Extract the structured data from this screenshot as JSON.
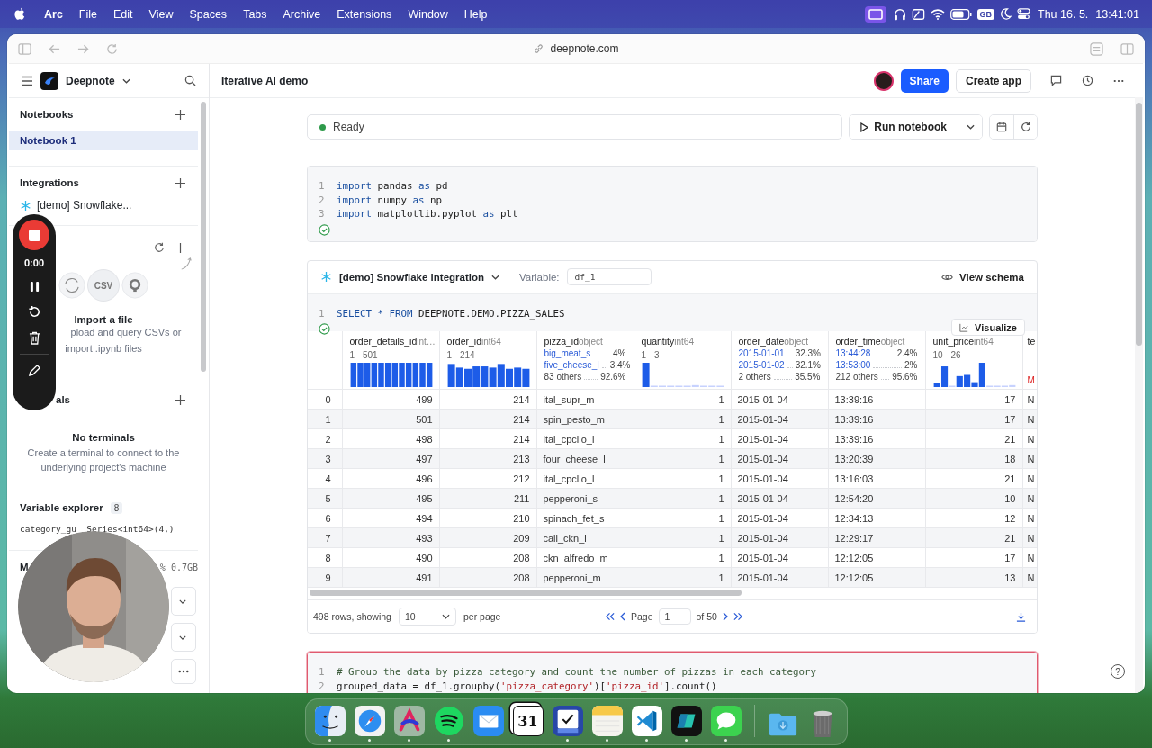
{
  "menu_bar": {
    "app": "Arc",
    "menus": [
      "File",
      "Edit",
      "View",
      "Spaces",
      "Tabs",
      "Archive",
      "Extensions",
      "Window",
      "Help"
    ],
    "keyboard": "GB",
    "date": "Thu 16. 5.",
    "time": "13:41:01"
  },
  "browser": {
    "url": "deepnote.com"
  },
  "recorder": {
    "timer": "0:00"
  },
  "sidebar": {
    "workspace": "Deepnote",
    "notebooks": {
      "title": "Notebooks",
      "items": [
        {
          "label": "Notebook 1",
          "selected": true
        }
      ]
    },
    "integrations": {
      "title": "Integrations",
      "items": [
        {
          "label": "[demo] Snowflake..."
        }
      ]
    },
    "files": {
      "csv_label": "CSV",
      "empty_title": "Import a file",
      "empty_lines": [
        "pload and query CSVs or",
        "import .ipynb files"
      ]
    },
    "terminals": {
      "title": "als",
      "empty_title": "No terminals",
      "empty_text": "Create a terminal to connect to the underlying project's machine"
    },
    "variables": {
      "title": "Variable explorer",
      "count": "8",
      "items": [
        {
          "name": "category_gu",
          "type": "Series<int64>(4,)"
        }
      ]
    },
    "machine": {
      "title": "M",
      "usage": "% 0.7GB"
    }
  },
  "notebook": {
    "title": "Iterative AI demo",
    "share": "Share",
    "create_app": "Create app",
    "status": "Ready",
    "run": "Run notebook",
    "help": "?"
  },
  "cells": [
    {
      "kind": "code",
      "highlighted": false,
      "done": true,
      "lines": [
        {
          "number": "1",
          "tokens": [
            {
              "text": "import",
              "kind": "keyword"
            },
            {
              "text": " pandas ",
              "kind": "plain"
            },
            {
              "text": "as",
              "kind": "keyword"
            },
            {
              "text": " pd",
              "kind": "plain"
            }
          ]
        },
        {
          "number": "2",
          "tokens": [
            {
              "text": "import",
              "kind": "keyword"
            },
            {
              "text": " numpy ",
              "kind": "plain"
            },
            {
              "text": "as",
              "kind": "keyword"
            },
            {
              "text": " np",
              "kind": "plain"
            }
          ]
        },
        {
          "number": "3",
          "tokens": [
            {
              "text": "import",
              "kind": "keyword"
            },
            {
              "text": " matplotlib.pyplot ",
              "kind": "plain"
            },
            {
              "text": "as",
              "kind": "keyword"
            },
            {
              "text": " plt",
              "kind": "plain"
            }
          ]
        }
      ]
    },
    {
      "kind": "sql",
      "highlighted": false,
      "done": true,
      "integration": "[demo] Snowflake integration",
      "variable_label": "Variable:",
      "variable": "df_1",
      "schema": "View schema",
      "visualize": "Visualize",
      "lines": [
        {
          "number": "1",
          "tokens": [
            {
              "text": "SELECT",
              "kind": "keyword"
            },
            {
              "text": " * ",
              "kind": "keyword"
            },
            {
              "text": "FROM",
              "kind": "keyword"
            },
            {
              "text": " DEEPNOTE.DEMO.PIZZA_SALES",
              "kind": "plain"
            }
          ]
        }
      ],
      "table": {
        "columns": [
          {
            "name": "order_details_id",
            "type": "int…",
            "summary": {
              "kind": "range",
              "range": "1 - 501"
            }
          },
          {
            "name": "order_id",
            "type": "int64",
            "summary": {
              "kind": "range",
              "range": "1 - 214"
            }
          },
          {
            "name": "pizza_id",
            "type": "object",
            "summary": {
              "kind": "top",
              "top": [
                {
                  "value": "big_meat_s",
                  "share": "4%"
                },
                {
                  "value": "five_cheese_l",
                  "share": "3.4%"
                }
              ],
              "others": {
                "value": "83 others",
                "share": "92.6%"
              }
            }
          },
          {
            "name": "quantity",
            "type": "int64",
            "summary": {
              "kind": "range",
              "range": "1 - 3"
            }
          },
          {
            "name": "order_date",
            "type": "object",
            "summary": {
              "kind": "top",
              "top": [
                {
                  "value": "2015-01-01",
                  "share": "32.3%"
                },
                {
                  "value": "2015-01-02",
                  "share": "32.1%"
                }
              ],
              "others": {
                "value": "2 others",
                "share": "35.5%"
              }
            }
          },
          {
            "name": "order_time",
            "type": "object",
            "summary": {
              "kind": "top",
              "top": [
                {
                  "value": "13:44:28",
                  "share": "2.4%"
                },
                {
                  "value": "13:53:00",
                  "share": "2%"
                }
              ],
              "others": {
                "value": "212 others",
                "share": "95.6%"
              }
            }
          },
          {
            "name": "unit_price",
            "type": "int64",
            "summary": {
              "kind": "range",
              "range": "10 - 26"
            }
          },
          {
            "name": "te",
            "summary": {
              "kind": "missing",
              "text": "M"
            }
          }
        ],
        "rows": [
          {
            "index": "0",
            "cells": [
              "499",
              "214",
              "ital_supr_m",
              "1",
              "2015-01-04",
              "13:39:16",
              "17",
              "N"
            ]
          },
          {
            "index": "1",
            "cells": [
              "501",
              "214",
              "spin_pesto_m",
              "1",
              "2015-01-04",
              "13:39:16",
              "17",
              "N"
            ]
          },
          {
            "index": "2",
            "cells": [
              "498",
              "214",
              "ital_cpcllo_l",
              "1",
              "2015-01-04",
              "13:39:16",
              "21",
              "N"
            ]
          },
          {
            "index": "3",
            "cells": [
              "497",
              "213",
              "four_cheese_l",
              "1",
              "2015-01-04",
              "13:20:39",
              "18",
              "N"
            ]
          },
          {
            "index": "4",
            "cells": [
              "496",
              "212",
              "ital_cpcllo_l",
              "1",
              "2015-01-04",
              "13:16:03",
              "21",
              "N"
            ]
          },
          {
            "index": "5",
            "cells": [
              "495",
              "211",
              "pepperoni_s",
              "1",
              "2015-01-04",
              "12:54:20",
              "10",
              "N"
            ]
          },
          {
            "index": "6",
            "cells": [
              "494",
              "210",
              "spinach_fet_s",
              "1",
              "2015-01-04",
              "12:34:13",
              "12",
              "N"
            ]
          },
          {
            "index": "7",
            "cells": [
              "493",
              "209",
              "cali_ckn_l",
              "1",
              "2015-01-04",
              "12:29:17",
              "21",
              "N"
            ]
          },
          {
            "index": "8",
            "cells": [
              "490",
              "208",
              "ckn_alfredo_m",
              "1",
              "2015-01-04",
              "12:12:05",
              "17",
              "N"
            ]
          },
          {
            "index": "9",
            "cells": [
              "491",
              "208",
              "pepperoni_m",
              "1",
              "2015-01-04",
              "12:12:05",
              "13",
              "N"
            ]
          }
        ],
        "footer": {
          "total": "498 rows, showing",
          "page_size": "10",
          "per_page": "per page",
          "page_label": "Page",
          "page": "1",
          "of": "of 50"
        }
      }
    },
    {
      "kind": "code",
      "highlighted": true,
      "lines": [
        {
          "number": "1",
          "tokens": [
            {
              "text": "# Group the data by pizza category and count the number of pizzas in each category",
              "kind": "comment"
            }
          ]
        },
        {
          "number": "2",
          "tokens": [
            {
              "text": "grouped_data = df_1.groupby(",
              "kind": "plain"
            },
            {
              "text": "'pizza_category'",
              "kind": "string"
            },
            {
              "text": ")[",
              "kind": "plain"
            },
            {
              "text": "'pizza_id'",
              "kind": "string"
            },
            {
              "text": "].count()",
              "kind": "plain"
            }
          ]
        }
      ]
    }
  ],
  "dock": {
    "apps": [
      {
        "running": true
      },
      {
        "running": true
      },
      {
        "running": true
      },
      {
        "running": true
      },
      {
        "running": false
      },
      {
        "running": false,
        "text": "31"
      },
      {
        "running": true
      },
      {
        "running": true
      },
      {
        "running": true
      },
      {
        "running": true
      },
      {
        "running": true
      }
    ]
  }
}
